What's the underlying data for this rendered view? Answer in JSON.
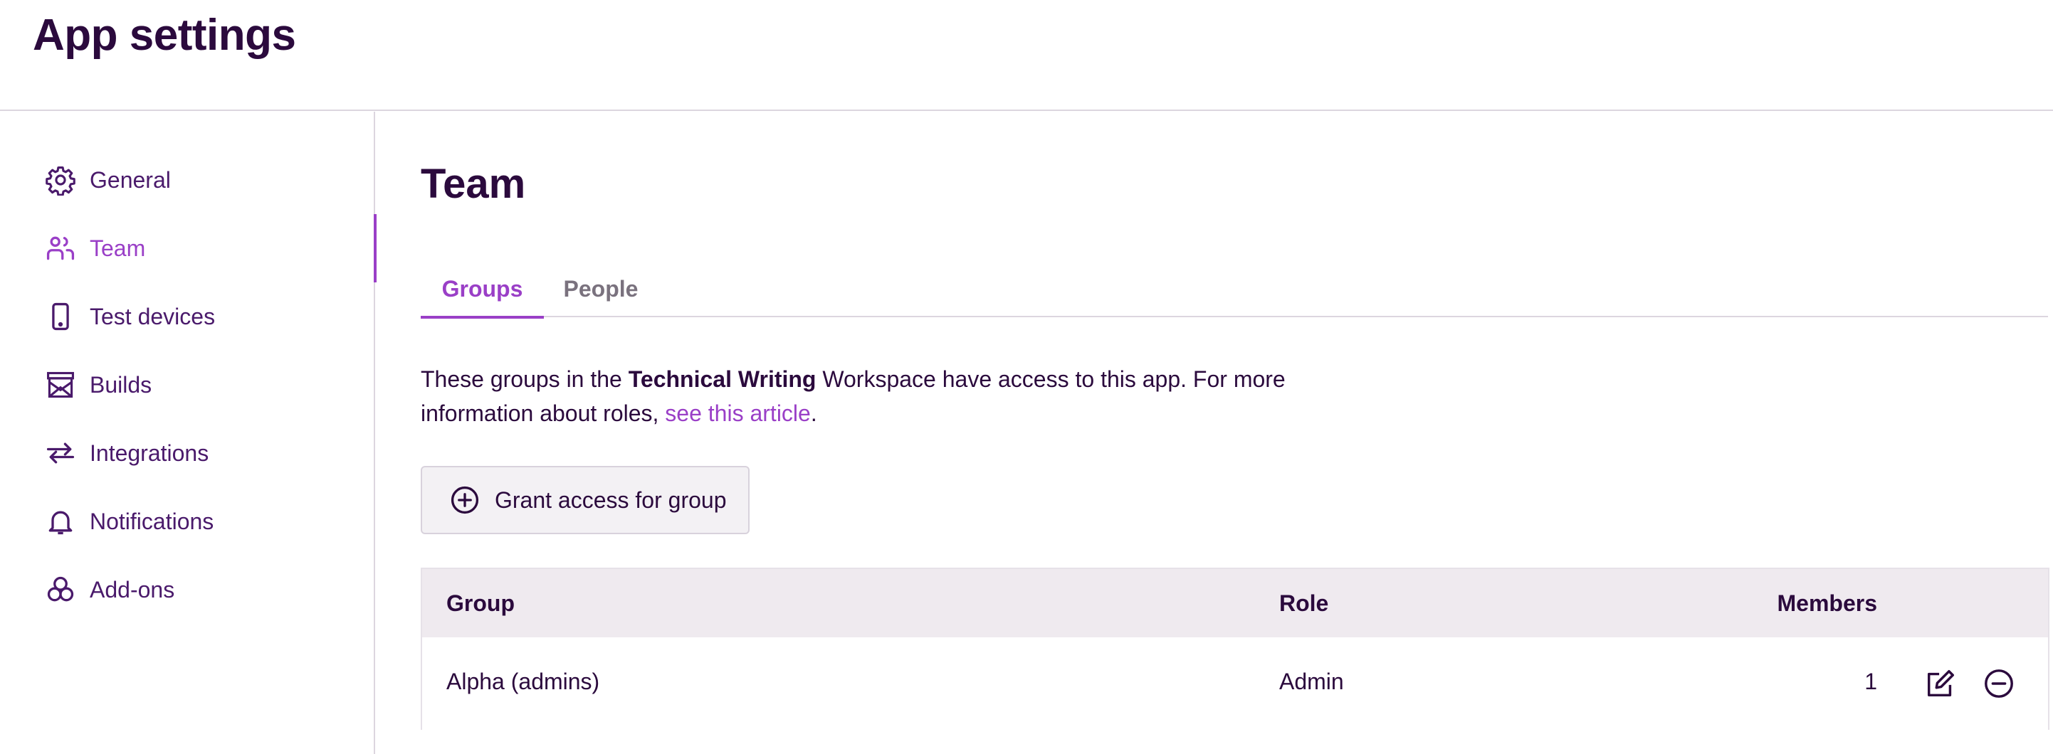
{
  "header": {
    "title": "App settings"
  },
  "sidebar": {
    "items": [
      {
        "label": "General",
        "icon": "gear-icon"
      },
      {
        "label": "Team",
        "icon": "team-icon",
        "active": true
      },
      {
        "label": "Test devices",
        "icon": "phone-icon"
      },
      {
        "label": "Builds",
        "icon": "builds-icon"
      },
      {
        "label": "Integrations",
        "icon": "arrows-icon"
      },
      {
        "label": "Notifications",
        "icon": "bell-icon"
      },
      {
        "label": "Add-ons",
        "icon": "addons-icon"
      }
    ]
  },
  "main": {
    "title": "Team",
    "tabs": [
      {
        "label": "Groups",
        "active": true
      },
      {
        "label": "People",
        "active": false
      }
    ],
    "description": {
      "before": "These groups in the ",
      "workspace": "Technical Writing",
      "middle": " Workspace have access to this app. For more information about roles, ",
      "link": "see this article",
      "after": "."
    },
    "grant_button": {
      "label": "Grant access for group",
      "icon": "plus-circle-icon"
    },
    "table": {
      "columns": [
        "Group",
        "Role",
        "Members"
      ],
      "rows": [
        {
          "group": "Alpha (admins)",
          "role": "Admin",
          "members": "1"
        }
      ]
    }
  },
  "colors": {
    "accent": "#9a3fc7",
    "text": "#2b0a3d",
    "nav_text": "#4a1a6b",
    "muted_tab": "#7a727e",
    "table_header_bg": "#efeaef",
    "divider": "#dcd6df"
  }
}
